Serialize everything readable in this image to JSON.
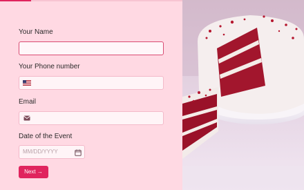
{
  "form": {
    "name_label": "Your Name",
    "name_value": "",
    "phone_label": "Your Phone number",
    "phone_value": "",
    "phone_flag_icon": "us-flag-icon",
    "email_label": "Email",
    "email_value": "",
    "email_icon": "envelope-icon",
    "date_label": "Date of the Event",
    "date_placeholder": "MM/DD/YYYY",
    "date_icon": "calendar-icon",
    "next_label": "Next →"
  },
  "progress": {
    "fraction": 0.17
  },
  "image": {
    "subject": "red velvet cake with slice removed"
  },
  "colors": {
    "accent": "#e0245e",
    "background": "#ffd9e3"
  }
}
